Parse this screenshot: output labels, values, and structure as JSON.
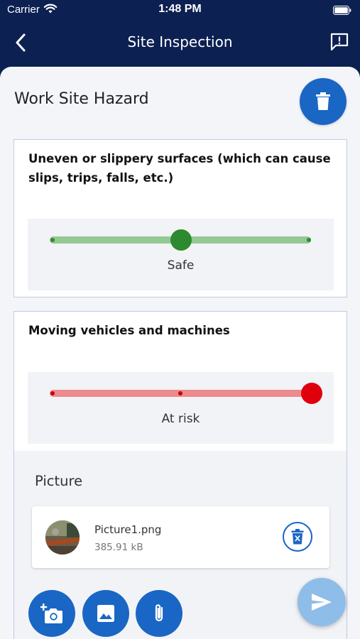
{
  "status_bar": {
    "carrier": "Carrier",
    "time": "1:48 PM"
  },
  "navbar": {
    "title": "Site Inspection",
    "back_icon": "chevron-left-icon",
    "feedback_icon": "feedback-icon"
  },
  "section": {
    "title": "Work Site Hazard",
    "delete_icon": "trash-icon"
  },
  "hazards": [
    {
      "question": "Uneven or slippery surfaces (which can cause slips, trips, falls, etc.)",
      "rating_label": "Safe",
      "rating_level": 0.5,
      "color": "#2d8a2f"
    },
    {
      "question": "Moving vehicles and machines",
      "rating_label": "At risk",
      "rating_level": 1.0,
      "color": "#e0000b"
    }
  ],
  "picture": {
    "title": "Picture",
    "attachment": {
      "file_name": "Picture1.png",
      "file_size": "385.91 kB"
    }
  },
  "actions": {
    "camera_icon": "add-photo-icon",
    "gallery_icon": "image-icon",
    "attach_icon": "paperclip-icon",
    "send_icon": "send-icon"
  },
  "colors": {
    "header": "#0c2052",
    "primary": "#1a66c4",
    "send_disabled": "#8ebde9",
    "background": "#f4f5f9"
  }
}
